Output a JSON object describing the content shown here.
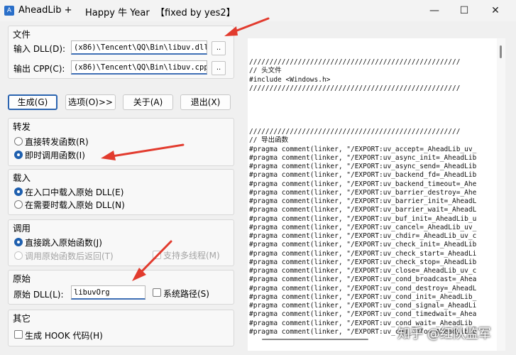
{
  "window": {
    "title": "AheadLib +",
    "subtitle": "Happy 牛 Year  【fixed by yes2】",
    "minimize": "—",
    "maximize": "☐",
    "close": "✕"
  },
  "file_group": {
    "title": "文件",
    "input_label": "输入 DLL(D):",
    "input_value": "(x86)\\Tencent\\QQ\\Bin\\libuv.dll",
    "output_label": "输出 CPP(C):",
    "output_value": "(x86)\\Tencent\\QQ\\Bin\\libuv.cpp",
    "browse": ".."
  },
  "buttons": {
    "generate": "生成(G)",
    "options": "选项(O)>>",
    "about": "关于(A)",
    "exit": "退出(X)"
  },
  "forward_group": {
    "title": "转发",
    "direct": "直接转发函数(R)",
    "instant": "即时调用函数(I)"
  },
  "load_group": {
    "title": "载入",
    "at_entry": "在入口中载入原始 DLL(E)",
    "on_demand": "在需要时载入原始 DLL(N)"
  },
  "call_group": {
    "title": "调用",
    "jump": "直接跳入原始函数(J)",
    "call_return": "调用原始函数后返回(T)",
    "multithread": "支持多线程(M)"
  },
  "origin_group": {
    "title": "原始",
    "dll_label": "原始 DLL(L):",
    "dll_value": "libuvOrg",
    "system_path": "系统路径(S)"
  },
  "other_group": {
    "title": "其它",
    "hook": "生成 HOOK 代码(H)"
  },
  "code": {
    "lines": [
      "////////////////////////////////////////////////////",
      "// 头文件",
      "#include <Windows.h>",
      "////////////////////////////////////////////////////",
      "",
      "",
      "",
      "",
      "////////////////////////////////////////////////////",
      "// 导出函数",
      "#pragma comment(linker, \"/EXPORT:uv_accept=_AheadLib_uv_",
      "#pragma comment(linker, \"/EXPORT:uv_async_init=_AheadLib",
      "#pragma comment(linker, \"/EXPORT:uv_async_send=_AheadLib",
      "#pragma comment(linker, \"/EXPORT:uv_backend_fd=_AheadLib",
      "#pragma comment(linker, \"/EXPORT:uv_backend_timeout=_Ahe",
      "#pragma comment(linker, \"/EXPORT:uv_barrier_destroy=_Ahe",
      "#pragma comment(linker, \"/EXPORT:uv_barrier_init=_AheadL",
      "#pragma comment(linker, \"/EXPORT:uv_barrier_wait=_AheadL",
      "#pragma comment(linker, \"/EXPORT:uv_buf_init=_AheadLib_u",
      "#pragma comment(linker, \"/EXPORT:uv_cancel=_AheadLib_uv_",
      "#pragma comment(linker, \"/EXPORT:uv_chdir=_AheadLib_uv_c",
      "#pragma comment(linker, \"/EXPORT:uv_check_init=_AheadLib",
      "#pragma comment(linker, \"/EXPORT:uv_check_start=_AheadLi",
      "#pragma comment(linker, \"/EXPORT:uv_check_stop=_AheadLib",
      "#pragma comment(linker, \"/EXPORT:uv_close=_AheadLib_uv_c",
      "#pragma comment(linker, \"/EXPORT:uv_cond_broadcast=_Ahea",
      "#pragma comment(linker, \"/EXPORT:uv_cond_destroy=_AheadL",
      "#pragma comment(linker, \"/EXPORT:uv_cond_init=_AheadLib_",
      "#pragma comment(linker, \"/EXPORT:uv_cond_signal=_AheadLi",
      "#pragma comment(linker, \"/EXPORT:uv_cond_timedwait=_Ahea",
      "#pragma comment(linker, \"/EXPORT:uv_cond_wait=_AheadLib_",
      "#pragma comment(linker, \"/EXPORT:uv_cpu_info=_AheadLib_u"
    ]
  },
  "watermark": "知乎 @红队监军",
  "colors": {
    "accent": "#1e5fae",
    "arrow": "#e23b2e"
  }
}
